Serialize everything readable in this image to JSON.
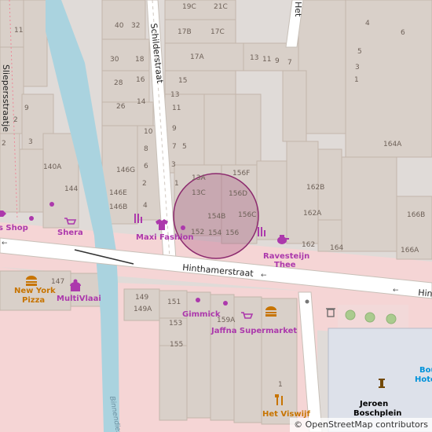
{
  "map": {
    "streets": {
      "hinthamerstraat": "Hinthamerstraat",
      "hinthamerstraat_cut": "Hint",
      "schilderstraat": "Schilderstraat",
      "sliepersstraatje": "Sliepersstraatje",
      "top_street_cut": "Het",
      "binnendieze": "Binnendieze"
    },
    "house_numbers": {
      "n19c": "19C",
      "n21c": "21C",
      "n40": "40",
      "n32": "32",
      "n17b": "17B",
      "n17c": "17C",
      "n17a": "17A",
      "n13": "13",
      "n11": "11",
      "n9": "9",
      "n7": "7",
      "n30": "30",
      "n18": "18",
      "n28": "28",
      "n16": "16",
      "n26": "26",
      "n14": "14",
      "n15": "15",
      "n13b": "13",
      "n11b": "11",
      "n9b": "9",
      "n7b": "7",
      "n5": "5",
      "n3": "3",
      "n1": "1",
      "n10": "10",
      "n8": "8",
      "n6": "6",
      "n4": "4",
      "n2": "2",
      "n146g": "146G",
      "n146e": "146E",
      "n146b": "146B",
      "n140a": "140A",
      "n144": "144",
      "n3left": "3",
      "n2left": "2",
      "n9left": "9",
      "n11left": "11",
      "n13a": "13A",
      "n13c": "13C",
      "n156f": "156F",
      "n156d": "156D",
      "n154b": "154B",
      "n156c": "156C",
      "n152": "152",
      "n154": "154",
      "n156": "156",
      "n162b": "162B",
      "n162a": "162A",
      "n162": "162",
      "n164": "164",
      "n164a": "164A",
      "n166b": "166B",
      "n166a": "166A",
      "n4r": "4",
      "n6r": "6",
      "n3r": "3",
      "n5r": "5",
      "n1r": "1",
      "n147": "147",
      "n149": "149",
      "n149a": "149A",
      "n151": "151",
      "n153": "153",
      "n155": "155",
      "n159a": "159A",
      "n1b": "1"
    },
    "pois": {
      "s_shop": "s Shop",
      "shera": "Shera",
      "maxi_fashion": "Maxi Fashion",
      "ravesteijn_1": "Ravesteijn",
      "ravesteijn_2": "Thee",
      "new_york_1": "New York",
      "new_york_2": "Pizza",
      "multivlaai": "MultiVlaai",
      "gimmick": "Gimmick",
      "jaffna": "Jaffna Supermarket",
      "het_viswijf": "Het Viswijf",
      "jeroen_1": "Jeroen",
      "jeroen_2": "Boschplein",
      "bou_1": "Bou",
      "bou_2": "Hote"
    },
    "icons": [
      "hairdresser-icon",
      "clothes-icon",
      "tea-icon",
      "fast-food-icon",
      "bakery-icon",
      "supermarket-icon",
      "seafood-icon",
      "statue-icon",
      "waste-basket-icon",
      "tree-icon",
      "shop-dot-icon"
    ],
    "colors": {
      "land": "#e0dbd8",
      "building": "#d9d0c9",
      "pedestrian": "#f5d5d5",
      "canal": "#aad3df",
      "road": "#ffffff",
      "poi_purple": "#ac39ac",
      "poi_orange": "#c77400",
      "highlight": "#a4547e"
    }
  },
  "attribution": "© OpenStreetMap contributors"
}
